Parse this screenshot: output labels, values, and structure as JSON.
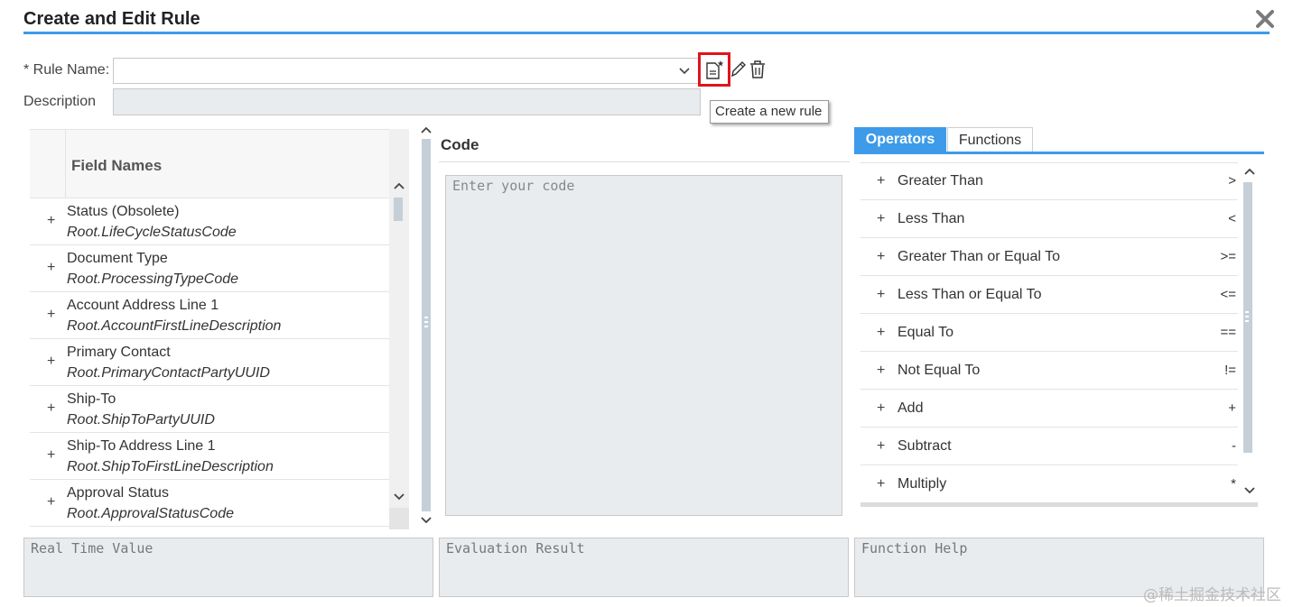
{
  "dialog": {
    "title": "Create and Edit Rule",
    "close_icon": "close-x-icon"
  },
  "rule_form": {
    "rule_name_label": "* Rule Name:",
    "rule_name_value": "",
    "description_label": "Description",
    "description_value": "",
    "icons": [
      "create-new-rule-icon",
      "pencil-icon",
      "trash-icon"
    ],
    "tooltip": "Create a new rule"
  },
  "fields": {
    "header": "Field Names",
    "items": [
      {
        "name": "Status (Obsolete)",
        "path": "Root.LifeCycleStatusCode"
      },
      {
        "name": "Document Type",
        "path": "Root.ProcessingTypeCode"
      },
      {
        "name": "Account Address Line 1",
        "path": "Root.AccountFirstLineDescription"
      },
      {
        "name": "Primary Contact",
        "path": "Root.PrimaryContactPartyUUID"
      },
      {
        "name": "Ship-To",
        "path": "Root.ShipToPartyUUID"
      },
      {
        "name": "Ship-To Address Line 1",
        "path": "Root.ShipToFirstLineDescription"
      },
      {
        "name": "Approval Status",
        "path": "Root.ApprovalStatusCode"
      }
    ]
  },
  "code": {
    "title": "Code",
    "placeholder": "Enter your code"
  },
  "operators_panel": {
    "tabs": [
      "Operators",
      "Functions"
    ],
    "active_tab": "Operators",
    "accent_color": "#3d9be9",
    "items": [
      {
        "name": "Greater Than",
        "symbol": ">"
      },
      {
        "name": "Less Than",
        "symbol": "<"
      },
      {
        "name": "Greater Than or Equal To",
        "symbol": ">="
      },
      {
        "name": "Less Than or Equal To",
        "symbol": "<="
      },
      {
        "name": "Equal To",
        "symbol": "=="
      },
      {
        "name": "Not Equal To",
        "symbol": "!="
      },
      {
        "name": "Add",
        "symbol": "+"
      },
      {
        "name": "Subtract",
        "symbol": "-"
      },
      {
        "name": "Multiply",
        "symbol": "*"
      }
    ]
  },
  "outputs": {
    "real_time_value": "Real Time Value",
    "evaluation_result": "Evaluation Result",
    "function_help": "Function Help"
  },
  "watermark": "@稀土掘金技术社区"
}
